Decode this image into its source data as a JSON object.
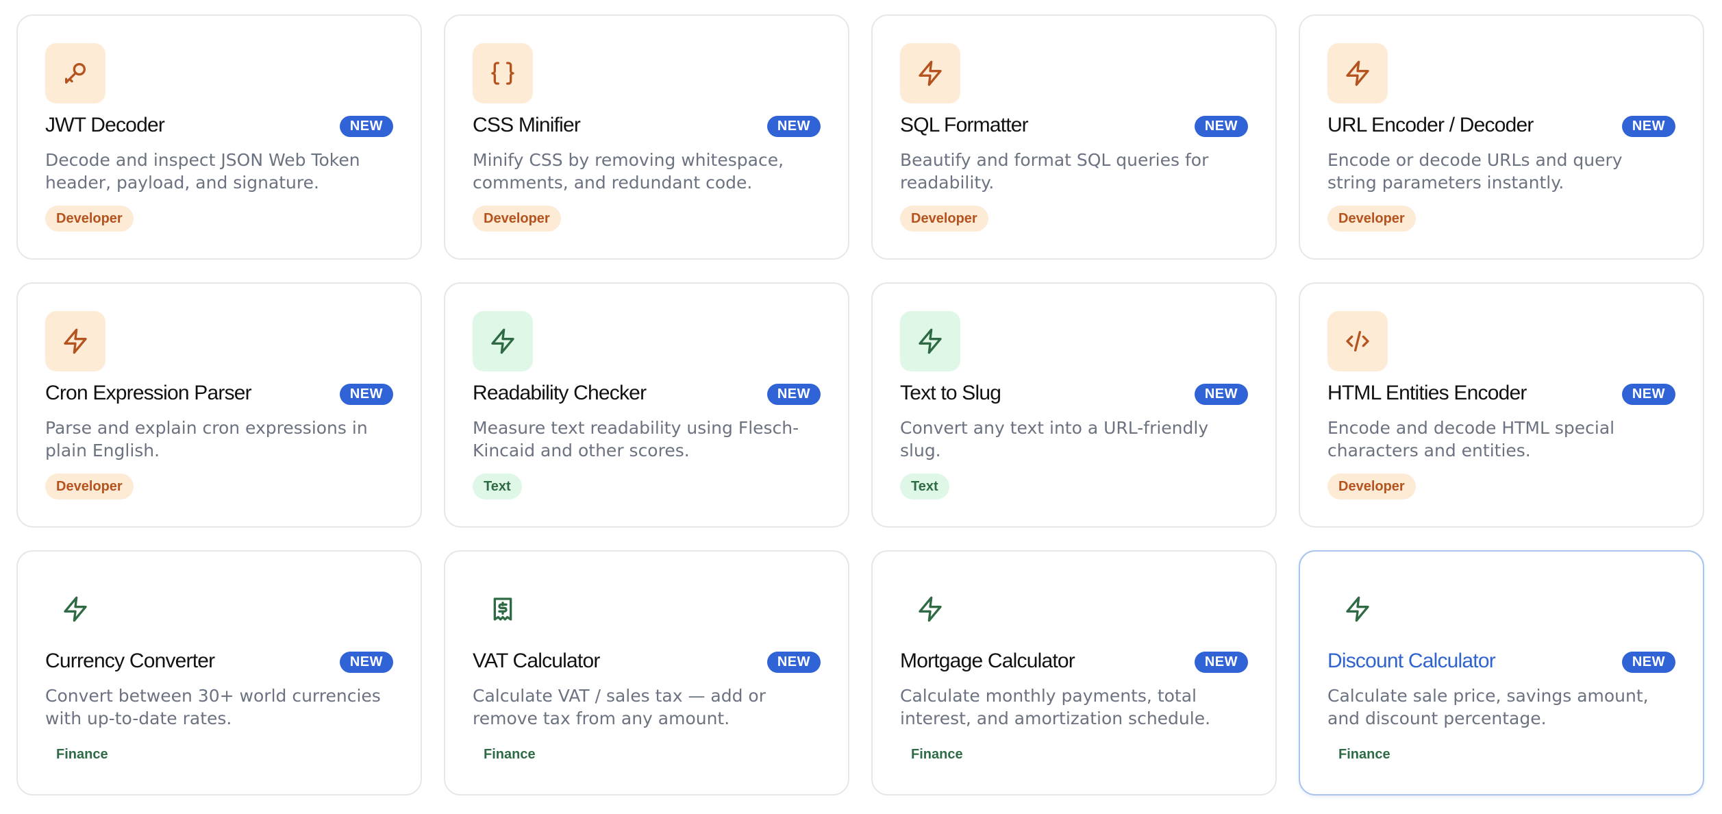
{
  "badge_label": "NEW",
  "colors": {
    "badge": "#2f63d6",
    "developer_bg": "#fdebd6",
    "developer_fg": "#b5531f",
    "text_bg": "#dff7e6",
    "text_fg": "#2e6b45",
    "active_title": "#2f63cf"
  },
  "tools": [
    {
      "title": "JWT Decoder",
      "desc": "Decode and inspect JSON Web Token header, payload, and signature.",
      "tag": "Developer",
      "icon": "key-icon"
    },
    {
      "title": "CSS Minifier",
      "desc": "Minify CSS by removing whitespace, comments, and redundant code.",
      "tag": "Developer",
      "icon": "braces-icon"
    },
    {
      "title": "SQL Formatter",
      "desc": "Beautify and format SQL queries for readability.",
      "tag": "Developer",
      "icon": "lightning-icon"
    },
    {
      "title": "URL Encoder / Decoder",
      "desc": "Encode or decode URLs and query string parameters instantly.",
      "tag": "Developer",
      "icon": "lightning-icon"
    },
    {
      "title": "Cron Expression Parser",
      "desc": "Parse and explain cron expressions in plain English.",
      "tag": "Developer",
      "icon": "lightning-icon"
    },
    {
      "title": "Readability Checker",
      "desc": "Measure text readability using Flesch-Kincaid and other scores.",
      "tag": "Text",
      "icon": "lightning-icon"
    },
    {
      "title": "Text to Slug",
      "desc": "Convert any text into a URL-friendly slug.",
      "tag": "Text",
      "icon": "lightning-icon"
    },
    {
      "title": "HTML Entities Encoder",
      "desc": "Encode and decode HTML special characters and entities.",
      "tag": "Developer",
      "icon": "code-icon"
    },
    {
      "title": "Currency Converter",
      "desc": "Convert between 30+ world currencies with up-to-date rates.",
      "tag": "Finance",
      "icon": "lightning-icon"
    },
    {
      "title": "VAT Calculator",
      "desc": "Calculate VAT / sales tax — add or remove tax from any amount.",
      "tag": "Finance",
      "icon": "receipt-dollar-icon"
    },
    {
      "title": "Mortgage Calculator",
      "desc": "Calculate monthly payments, total interest, and amortization schedule.",
      "tag": "Finance",
      "icon": "lightning-icon"
    },
    {
      "title": "Discount Calculator",
      "desc": "Calculate sale price, savings amount, and discount percentage.",
      "tag": "Finance",
      "icon": "lightning-icon"
    }
  ]
}
